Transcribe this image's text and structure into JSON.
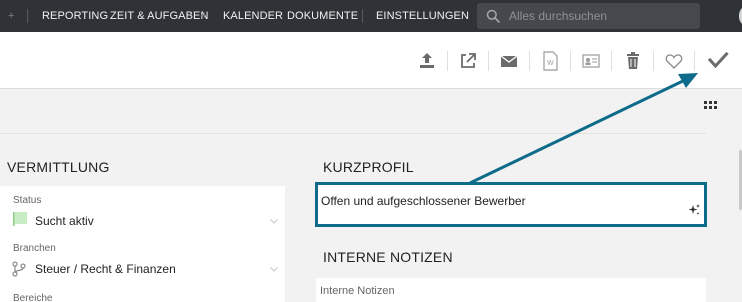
{
  "nav": {
    "items": [
      "REPORTING",
      "ZEIT & AUFGABEN",
      "KALENDER",
      "DOKUMENTE",
      "EINSTELLUNGEN"
    ],
    "plus_symbol": "+"
  },
  "search": {
    "placeholder": "Alles durchsuchen",
    "icon": "search-icon"
  },
  "toolbar": {
    "icons": [
      "upload-icon",
      "external-link-icon",
      "mail-icon",
      "word-document-icon",
      "contact-card-icon",
      "trash-icon",
      "heart-icon",
      "checkmark-icon"
    ]
  },
  "vermittlung": {
    "title": "VERMITTLUNG",
    "status": {
      "label": "Status",
      "value": "Sucht aktiv",
      "flag_color": "#c8edc4"
    },
    "branchen": {
      "label": "Branchen",
      "value": "Steuer / Recht & Finanzen"
    },
    "bereiche": {
      "label": "Bereiche"
    }
  },
  "kurzprofil": {
    "title": "KURZPROFIL",
    "text": "Offen und aufgeschlossener Bewerber",
    "highlight_color": "#0f6b8a"
  },
  "interne_notizen": {
    "title": "INTERNE NOTIZEN",
    "placeholder": "Interne Notizen"
  }
}
